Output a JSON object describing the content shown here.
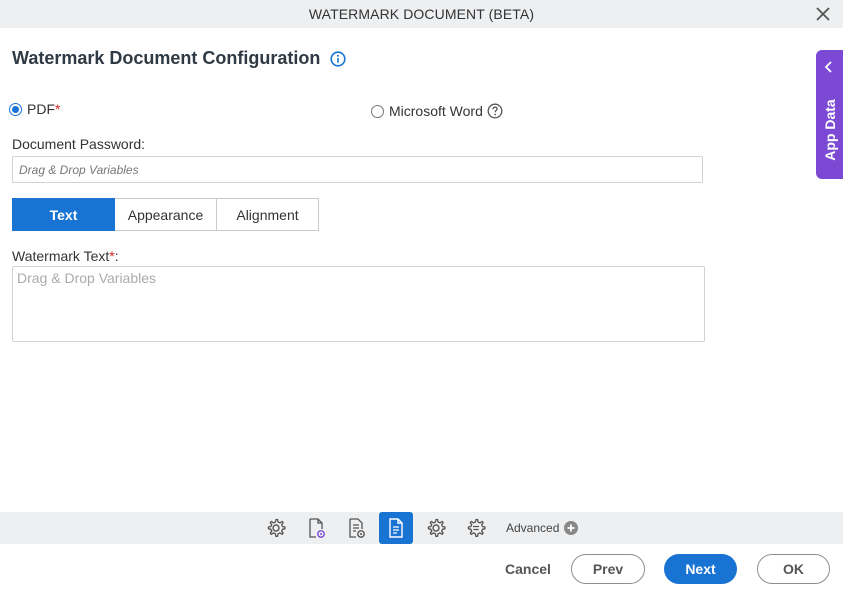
{
  "window": {
    "title": "WATERMARK DOCUMENT (BETA)"
  },
  "page": {
    "heading": "Watermark Document Configuration"
  },
  "document_type": {
    "options": [
      {
        "label": "PDF",
        "required_mark": "*",
        "selected": true
      },
      {
        "label": "Microsoft Word",
        "selected": false
      }
    ]
  },
  "password": {
    "label": "Document Password:",
    "placeholder": "Drag & Drop Variables"
  },
  "tabs": [
    {
      "label": "Text",
      "active": true
    },
    {
      "label": "Appearance",
      "active": false
    },
    {
      "label": "Alignment",
      "active": false
    }
  ],
  "watermark_text": {
    "label": "Watermark Text",
    "required_mark": "*",
    "suffix": ":",
    "placeholder": "Drag & Drop Variables"
  },
  "side_panel": {
    "label": "App Data"
  },
  "toolbar": {
    "icons": [
      "gear-icon",
      "document-settings-icon",
      "form-settings-icon",
      "document-list-icon",
      "cog-icon",
      "filter-settings-icon"
    ],
    "active_icon": "document-list-icon",
    "advanced_label": "Advanced"
  },
  "footer": {
    "cancel": "Cancel",
    "prev": "Prev",
    "next": "Next",
    "ok": "OK"
  },
  "colors": {
    "primary": "#1873d3",
    "side_panel": "#7b49d4",
    "required": "#d0271d"
  }
}
